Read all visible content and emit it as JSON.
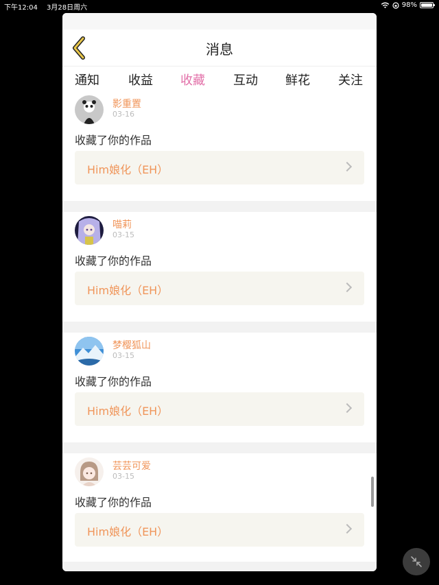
{
  "status": {
    "time": "下午12:04",
    "date": "3月28日周六",
    "battery": "98%",
    "battery_level": 0.98
  },
  "header": {
    "title": "消息"
  },
  "tabs": [
    {
      "label": "通知"
    },
    {
      "label": "收益"
    },
    {
      "label": "收藏",
      "active": true
    },
    {
      "label": "互动"
    },
    {
      "label": "鲜花"
    },
    {
      "label": "关注"
    }
  ],
  "items": [
    {
      "user": "影重置",
      "date": "03-16",
      "action": "收藏了你的作品",
      "work": "Him娘化（EH）"
    },
    {
      "user": "喵莉",
      "date": "03-15",
      "action": "收藏了你的作品",
      "work": "Him娘化（EH）"
    },
    {
      "user": "梦樱狐山",
      "date": "03-15",
      "action": "收藏了你的作品",
      "work": "Him娘化（EH）"
    },
    {
      "user": "芸芸可爱",
      "date": "03-15",
      "action": "收藏了你的作品",
      "work": "Him娘化（EH）"
    }
  ],
  "colors": {
    "accent": "#e26fa8",
    "name": "#f0955a",
    "back": "#e8c64a"
  }
}
